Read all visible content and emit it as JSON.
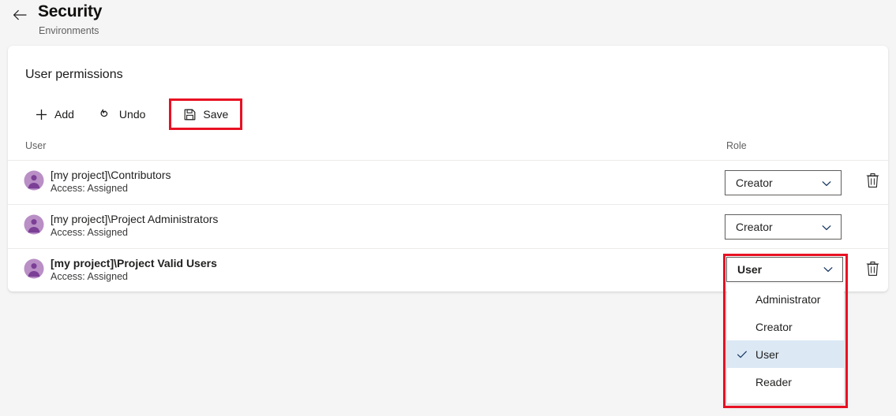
{
  "header": {
    "back_icon": "arrow-left-icon",
    "title": "Security",
    "subtitle": "Environments"
  },
  "card": {
    "title": "User permissions",
    "toolbar": {
      "add_label": "Add",
      "add_icon": "plus-icon",
      "undo_label": "Undo",
      "undo_icon": "undo-arrow-icon",
      "save_label": "Save",
      "save_icon": "floppy-disk-save-icon",
      "save_highlight_color": "#e81123"
    },
    "columns": {
      "user": "User",
      "role": "Role"
    },
    "rows": [
      {
        "name": "[my project]\\Contributors",
        "access": "Access: Assigned",
        "role": "Creator",
        "avatar_icon": "group-avatar-icon",
        "delete_icon": "trash-icon",
        "has_delete": true,
        "selected": false
      },
      {
        "name": "[my project]\\Project Administrators",
        "access": "Access: Assigned",
        "role": "Creator",
        "avatar_icon": "group-avatar-icon",
        "delete_icon": "trash-icon",
        "has_delete": false,
        "selected": false
      },
      {
        "name": "[my project]\\Project Valid Users",
        "access": "Access: Assigned",
        "role": "User",
        "avatar_icon": "group-avatar-icon",
        "delete_icon": "trash-icon",
        "has_delete": true,
        "selected": true
      }
    ]
  },
  "dropdown": {
    "selected_value": "User",
    "highlight_color": "#e81123",
    "selected_row_bg": "#dce9f5",
    "options": [
      {
        "label": "Administrator",
        "checked": false
      },
      {
        "label": "Creator",
        "checked": false
      },
      {
        "label": "User",
        "checked": true
      },
      {
        "label": "Reader",
        "checked": false
      }
    ]
  },
  "colors": {
    "page_background": "#f5f5f5",
    "card_background": "#ffffff",
    "avatar_fill": "#b98fc6",
    "avatar_glyph": "#7b3f96",
    "accent_red": "#e81123"
  }
}
